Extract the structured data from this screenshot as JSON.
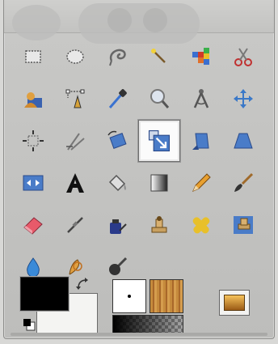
{
  "toolbox": {
    "active_tool": "scale-tool",
    "tools": [
      {
        "name": "rect-select-tool-icon"
      },
      {
        "name": "ellipse-select-tool-icon"
      },
      {
        "name": "free-select-tool-icon"
      },
      {
        "name": "fuzzy-select-tool-icon"
      },
      {
        "name": "select-by-color-tool-icon"
      },
      {
        "name": "scissors-select-tool-icon"
      },
      {
        "name": "foreground-select-tool-icon"
      },
      {
        "name": "paths-tool-icon"
      },
      {
        "name": "color-picker-tool-icon"
      },
      {
        "name": "zoom-tool-icon"
      },
      {
        "name": "measure-tool-icon"
      },
      {
        "name": "move-tool-icon"
      },
      {
        "name": "align-tool-icon"
      },
      {
        "name": "crop-tool-icon"
      },
      {
        "name": "rotate-tool-icon"
      },
      {
        "name": "scale-tool-icon"
      },
      {
        "name": "shear-tool-icon"
      },
      {
        "name": "perspective-tool-icon"
      },
      {
        "name": "flip-tool-icon"
      },
      {
        "name": "text-tool-icon"
      },
      {
        "name": "bucket-fill-tool-icon"
      },
      {
        "name": "blend-tool-icon"
      },
      {
        "name": "pencil-tool-icon"
      },
      {
        "name": "paintbrush-tool-icon"
      },
      {
        "name": "eraser-tool-icon"
      },
      {
        "name": "airbrush-tool-icon"
      },
      {
        "name": "ink-tool-icon"
      },
      {
        "name": "clone-tool-icon"
      },
      {
        "name": "heal-tool-icon"
      },
      {
        "name": "perspective-clone-tool-icon"
      },
      {
        "name": "blur-sharpen-tool-icon"
      },
      {
        "name": "smudge-tool-icon"
      },
      {
        "name": "dodge-burn-tool-icon"
      }
    ]
  },
  "colors": {
    "foreground": "#000000",
    "background": "#f4f4f2",
    "window_bg": "#c3c3c1",
    "active_highlight": "#ffffff"
  }
}
